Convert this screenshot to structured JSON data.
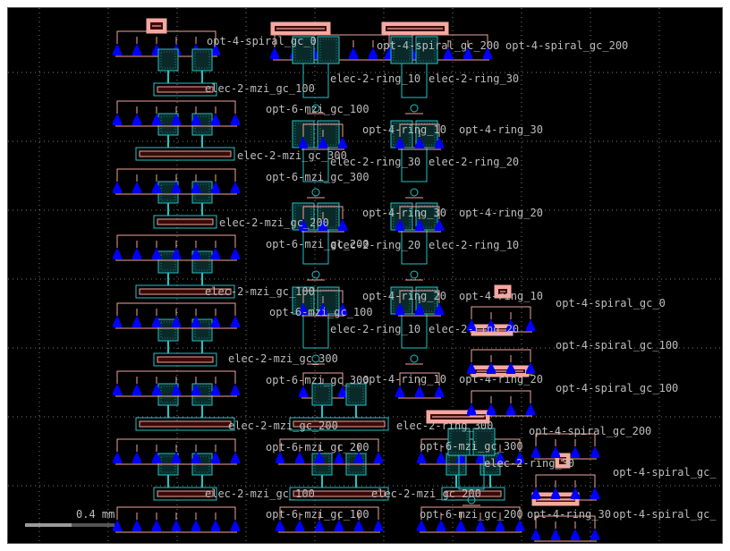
{
  "colors": {
    "background": "#000000",
    "grid": "#7a7a7a",
    "waveguide": "#f0a59a",
    "pad_fill": "#f5a8a0",
    "pad_dark": "#3a0a0a",
    "grating": "#0000ff",
    "metal": "#22c4c4",
    "metal_fill": "#0a2a2a",
    "label": "#bdbdbd",
    "scale_bar": "#9a9a9a"
  },
  "scale_bar": {
    "label": "0.4 mm"
  },
  "labels": {
    "l01": "opt-4-spiral_gc_0",
    "l02": "opt-4-spiral_gc_200",
    "l03": "opt-4-spiral_gc_200",
    "l04": "elec-2-mzi_gc_100",
    "l05": "elec-2-ring_10",
    "l06": "elec-2-ring_30",
    "l07": "opt-6-mzi_gc_100",
    "l08": "opt-4-ring_10",
    "l09": "opt-4-ring_30",
    "l10": "elec-2-mzi_gc_300",
    "l11": "elec-2-ring_30",
    "l12": "elec-2-ring_20",
    "l13": "opt-6-mzi_gc_300",
    "l14": "opt-4-ring_30",
    "l15": "opt-4-ring_20",
    "l16": "elec-2-mzi_gc_200",
    "l17": "opt-6-mzi_gc_200",
    "l18": "elec-2-ring_20",
    "l19": "elec-2-ring_10",
    "l20": "elec-2-mzi_gc_100",
    "l21": "opt-4-ring_20",
    "l22": "opt-4-ring_10",
    "l23": "opt-4-spiral_gc_0",
    "l24": "opt-6-mzi_gc_100",
    "l25": "elec-2-ring_10",
    "l26": "elec-2-ring_20",
    "l27": "opt-4-spiral_gc_100",
    "l28": "elec-2-mzi_gc_300",
    "l29": "opt-6-mzi_gc_300",
    "l30": "opt-4-ring_10",
    "l31": "opt-4-ring_20",
    "l32": "opt-4-spiral_gc_100",
    "l33": "elec-2-mzi_gc_200",
    "l34": "elec-2-ring_300",
    "l35": "opt-4-spiral_gc_200",
    "l36": "opt-6-mzi_gc_200",
    "l37": "opt-6-mzi_gc_300",
    "l38": "elec-2-ring_30",
    "l39": "opt-4-spiral_gc_",
    "l40": "elec-2-mzi_gc_100",
    "l41": "elec-2-mzi_gc_200",
    "l42": "opt-6-mzi_gc_100",
    "l43": "opt-6-mzi_gc_200",
    "l44": "opt-4-ring_30",
    "l45": "opt-4-spiral_gc_"
  }
}
